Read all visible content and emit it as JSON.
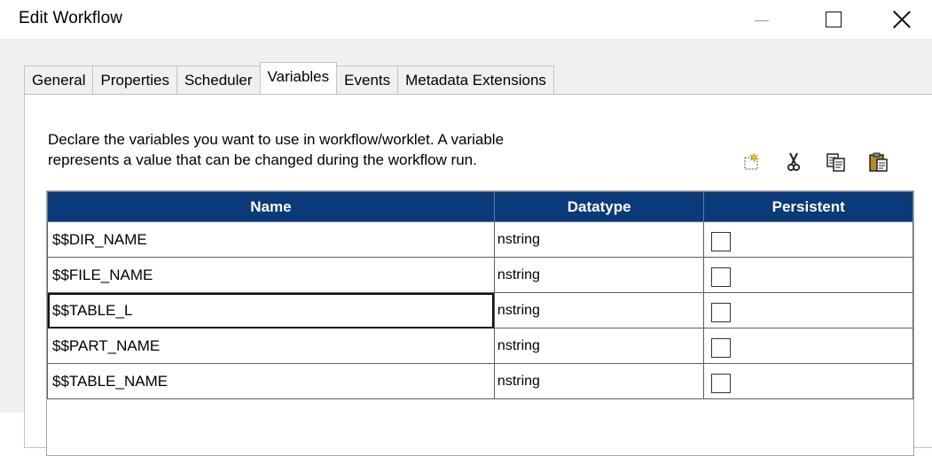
{
  "window": {
    "title": "Edit Workflow"
  },
  "tabs": [
    {
      "label": "General",
      "active": false
    },
    {
      "label": "Properties",
      "active": false
    },
    {
      "label": "Scheduler",
      "active": false
    },
    {
      "label": "Variables",
      "active": true
    },
    {
      "label": "Events",
      "active": false
    },
    {
      "label": "Metadata Extensions",
      "active": false
    }
  ],
  "description": {
    "line1": "Declare the variables you want to use in workflow/worklet.  A variable",
    "line2": "represents a value that can be changed during the workflow run."
  },
  "toolbar": {
    "icons": [
      "new-row-icon",
      "cut-icon",
      "copy-icon",
      "paste-icon"
    ]
  },
  "grid": {
    "columns": [
      "Name",
      "Datatype",
      "Persistent"
    ],
    "header_color": "#0b3a79",
    "rows": [
      {
        "name": "$$DIR_NAME",
        "datatype": "nstring",
        "persistent": false
      },
      {
        "name": "$$FILE_NAME",
        "datatype": "nstring",
        "persistent": false
      },
      {
        "name": "$$TABLE_L",
        "datatype": "nstring",
        "persistent": false,
        "selected": true
      },
      {
        "name": "$$PART_NAME",
        "datatype": "nstring",
        "persistent": false
      },
      {
        "name": "$$TABLE_NAME",
        "datatype": "nstring",
        "persistent": false
      }
    ]
  }
}
